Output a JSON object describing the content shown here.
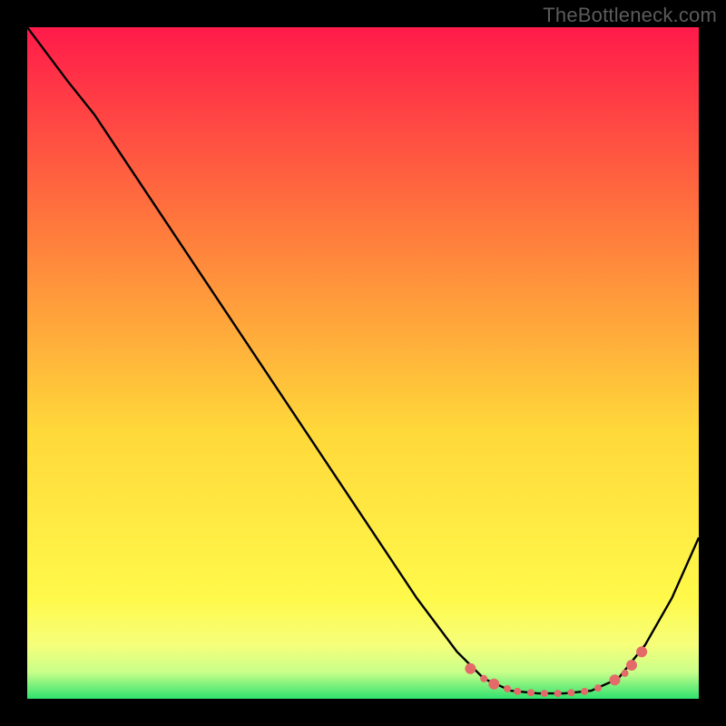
{
  "watermark": "TheBottleneck.com",
  "chart_data": {
    "type": "line",
    "title": "",
    "xlabel": "",
    "ylabel": "",
    "xlim": [
      0,
      100
    ],
    "ylim": [
      0,
      100
    ],
    "background_gradient": {
      "top": "#ff1a4a",
      "mid1": "#ff7a3c",
      "mid2": "#ffd83a",
      "mid3": "#fff94a",
      "bottom": "#2fe26e"
    },
    "series": [
      {
        "name": "bottleneck-curve",
        "type": "line",
        "stroke": "#000000",
        "stroke_width": 2,
        "points": [
          {
            "x": 0,
            "y": 100
          },
          {
            "x": 6,
            "y": 92
          },
          {
            "x": 10,
            "y": 87
          },
          {
            "x": 20,
            "y": 72
          },
          {
            "x": 30,
            "y": 57
          },
          {
            "x": 40,
            "y": 42
          },
          {
            "x": 50,
            "y": 27
          },
          {
            "x": 58,
            "y": 15
          },
          {
            "x": 64,
            "y": 7
          },
          {
            "x": 68,
            "y": 3
          },
          {
            "x": 72,
            "y": 1.2
          },
          {
            "x": 76,
            "y": 0.8
          },
          {
            "x": 80,
            "y": 0.8
          },
          {
            "x": 84,
            "y": 1.2
          },
          {
            "x": 88,
            "y": 3
          },
          {
            "x": 92,
            "y": 8
          },
          {
            "x": 96,
            "y": 15
          },
          {
            "x": 100,
            "y": 24
          }
        ]
      }
    ],
    "markers": {
      "name": "bottom-dots",
      "color": "#e46a6a",
      "radius_major": 6,
      "radius_minor": 4,
      "points": [
        {
          "x": 66,
          "y": 4.5,
          "r": 6
        },
        {
          "x": 68,
          "y": 3.0,
          "r": 4
        },
        {
          "x": 69.5,
          "y": 2.2,
          "r": 6
        },
        {
          "x": 71.5,
          "y": 1.5,
          "r": 4
        },
        {
          "x": 73,
          "y": 1.1,
          "r": 4
        },
        {
          "x": 75,
          "y": 0.9,
          "r": 4
        },
        {
          "x": 77,
          "y": 0.8,
          "r": 4
        },
        {
          "x": 79,
          "y": 0.8,
          "r": 4
        },
        {
          "x": 81,
          "y": 0.9,
          "r": 4
        },
        {
          "x": 83,
          "y": 1.1,
          "r": 4
        },
        {
          "x": 85,
          "y": 1.6,
          "r": 4
        },
        {
          "x": 87.5,
          "y": 2.8,
          "r": 6
        },
        {
          "x": 89,
          "y": 3.8,
          "r": 4
        },
        {
          "x": 90,
          "y": 5.0,
          "r": 6
        },
        {
          "x": 91.5,
          "y": 7.0,
          "r": 6
        }
      ]
    }
  }
}
